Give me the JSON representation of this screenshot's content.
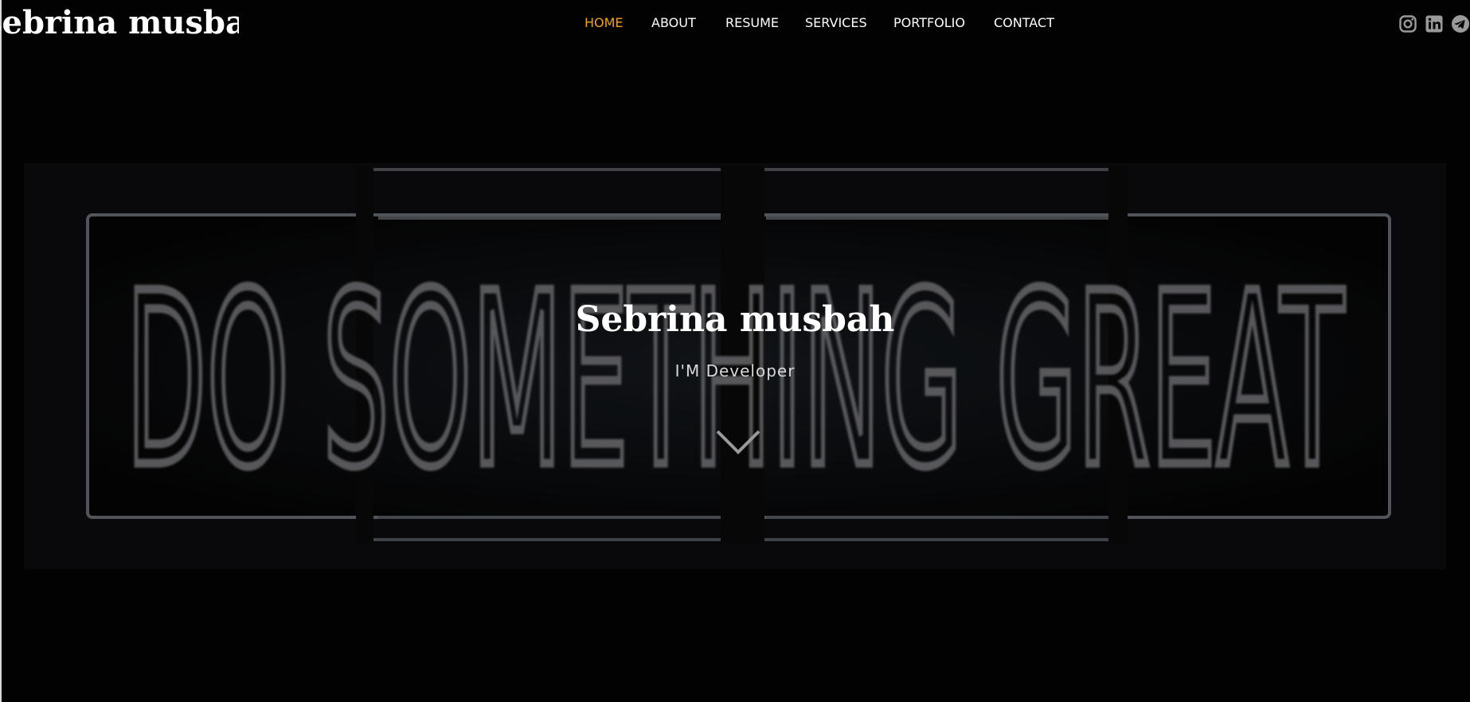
{
  "header": {
    "brand": "sebrina musbah",
    "nav": [
      {
        "label": "HOME",
        "active": true
      },
      {
        "label": "ABOUT",
        "active": false
      },
      {
        "label": "RESUME",
        "active": false
      },
      {
        "label": "SERVICES",
        "active": false
      },
      {
        "label": "PORTFOLIO",
        "active": false
      },
      {
        "label": "CONTACT",
        "active": false
      }
    ],
    "social_icons": [
      "instagram-icon",
      "linkedin-icon",
      "telegram-icon"
    ]
  },
  "hero": {
    "title": "Sebrina musbah",
    "subtitle": "I'M Developer",
    "background_sign_text": "DO SOMETHING GREAT",
    "scroll_icon": "chevron-down-icon"
  },
  "colors": {
    "accent": "#f0a21a",
    "background": "#030303",
    "neon": "#7c7c80"
  }
}
